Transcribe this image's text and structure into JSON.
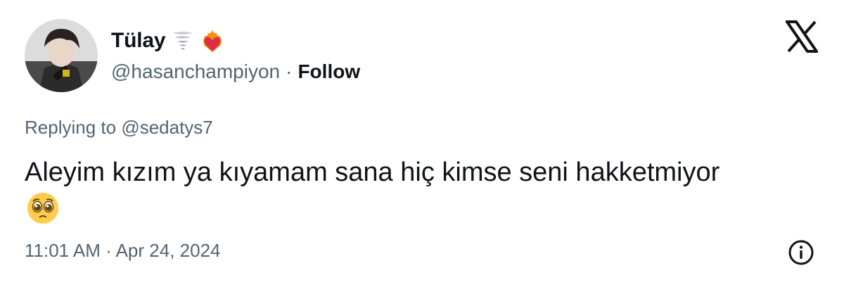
{
  "user": {
    "display_name": "Tülay",
    "handle": "@hasanchampiyon",
    "separator": "·",
    "follow_label": "Follow",
    "name_emojis": [
      "tornado-emoji",
      "heart-on-fire-emoji"
    ],
    "avatar": "profile-photo"
  },
  "brand": {
    "logo": "x-logo-icon"
  },
  "reply": {
    "prefix": "Replying to",
    "mention": "@sedatys7"
  },
  "tweet": {
    "text": "Aleyim kızım ya kıyamam sana hiç kimse seni hakketmiyor",
    "emoji": "pleading-face-emoji"
  },
  "meta": {
    "timestamp": "11:01 AM · Apr 24, 2024",
    "info_icon": "info-icon"
  },
  "colors": {
    "text_primary": "#0f1419",
    "text_secondary": "#536471",
    "background": "#ffffff"
  }
}
